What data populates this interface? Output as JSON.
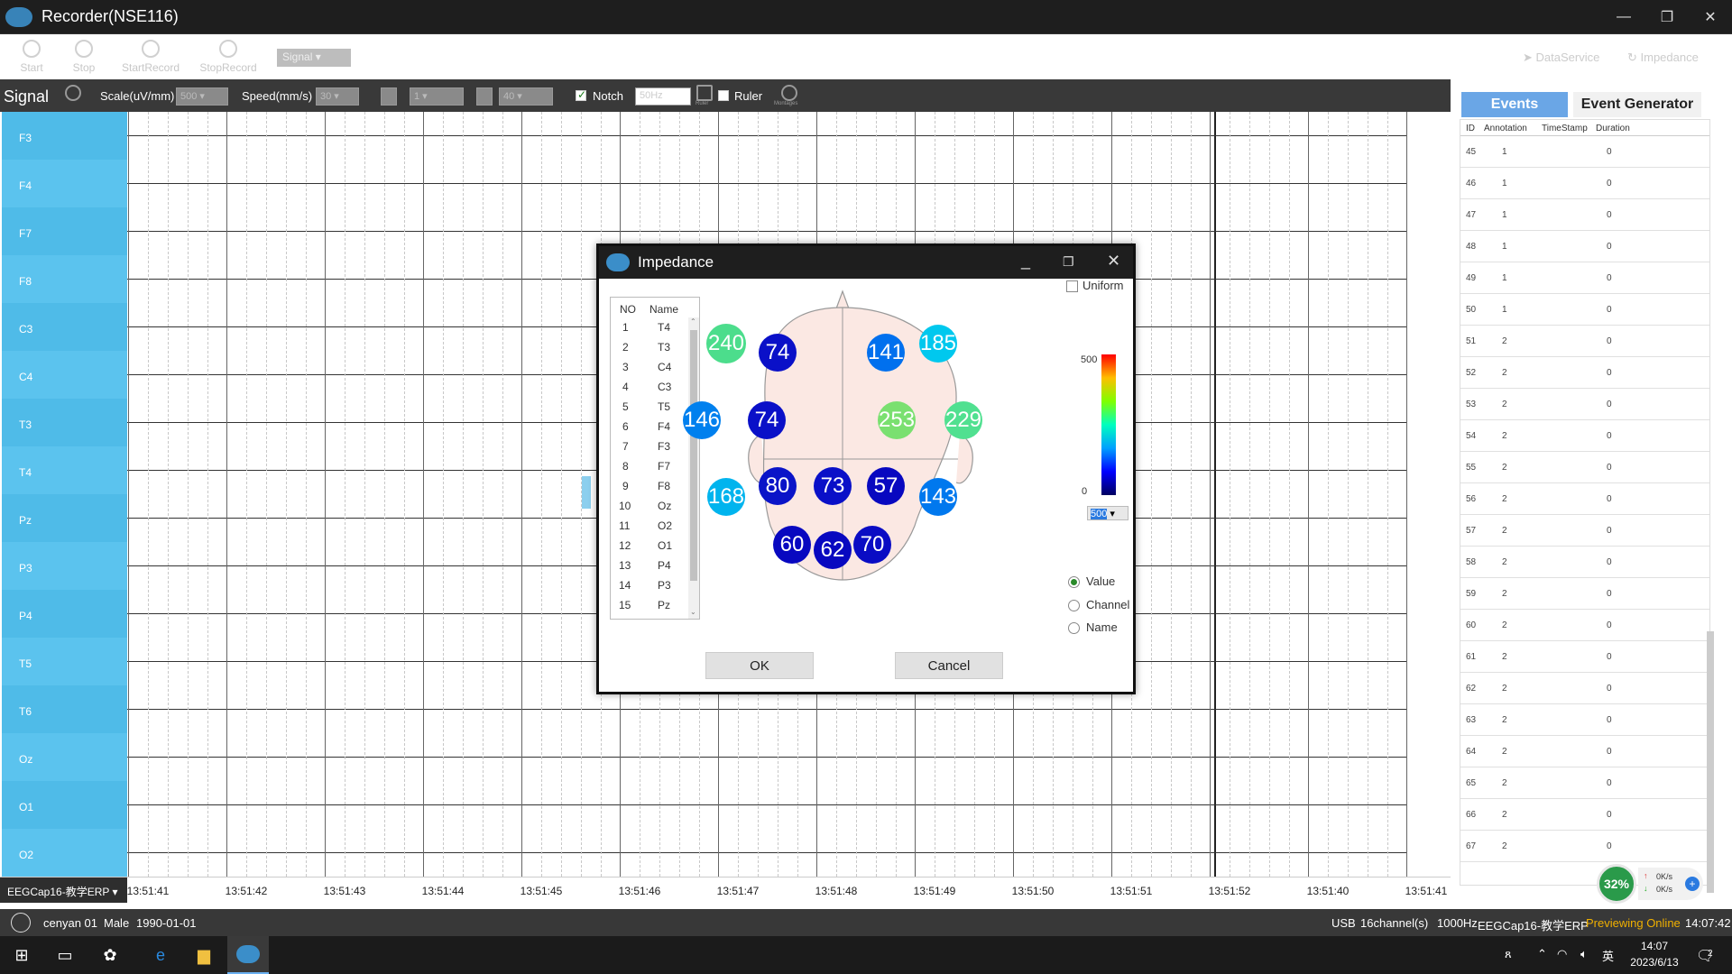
{
  "window": {
    "title": "Recorder(NSE116)"
  },
  "toolbar": {
    "start": "Start",
    "stop": "Stop",
    "start_record": "StartRecord",
    "stop_record": "StopRecord",
    "mode_select": "Signal",
    "data_service": "DataService",
    "impedance": "Impedance"
  },
  "signal_bar": {
    "title": "Signal",
    "reset": "Reset",
    "scale_label": "Scale(uV/mm)",
    "scale_value": "500",
    "speed_label": "Speed(mm/s)",
    "speed_value": "30",
    "low_value": "1",
    "high_value": "40",
    "notch_label": "Notch",
    "notch_checked": true,
    "notch_value": "50Hz",
    "ruler_icon_label": "Ruler",
    "ruler_label": "Ruler",
    "montages_label": "Montages"
  },
  "channels": [
    "F3",
    "F4",
    "F7",
    "F8",
    "C3",
    "C4",
    "T3",
    "T4",
    "Pz",
    "P3",
    "P4",
    "T5",
    "T6",
    "Oz",
    "O1",
    "O2"
  ],
  "time_axis": {
    "montage": "EEGCap16-教学ERP",
    "ticks": [
      "13:51:41",
      "13:51:42",
      "13:51:43",
      "13:51:44",
      "13:51:45",
      "13:51:46",
      "13:51:47",
      "13:51:48",
      "13:51:49",
      "13:51:50",
      "13:51:51",
      "13:51:52",
      "13:51:40",
      "13:51:41"
    ]
  },
  "right_panel": {
    "tab_events": "Events",
    "tab_generator": "Event Generator",
    "headers": [
      "ID",
      "Annotation",
      "TimeStamp",
      "Duration"
    ],
    "rows": [
      {
        "id": "45",
        "annotation": "1",
        "timestamp": "",
        "duration": "0"
      },
      {
        "id": "46",
        "annotation": "1",
        "timestamp": "",
        "duration": "0"
      },
      {
        "id": "47",
        "annotation": "1",
        "timestamp": "",
        "duration": "0"
      },
      {
        "id": "48",
        "annotation": "1",
        "timestamp": "",
        "duration": "0"
      },
      {
        "id": "49",
        "annotation": "1",
        "timestamp": "",
        "duration": "0"
      },
      {
        "id": "50",
        "annotation": "1",
        "timestamp": "",
        "duration": "0"
      },
      {
        "id": "51",
        "annotation": "2",
        "timestamp": "",
        "duration": "0"
      },
      {
        "id": "52",
        "annotation": "2",
        "timestamp": "",
        "duration": "0"
      },
      {
        "id": "53",
        "annotation": "2",
        "timestamp": "",
        "duration": "0"
      },
      {
        "id": "54",
        "annotation": "2",
        "timestamp": "",
        "duration": "0"
      },
      {
        "id": "55",
        "annotation": "2",
        "timestamp": "",
        "duration": "0"
      },
      {
        "id": "56",
        "annotation": "2",
        "timestamp": "",
        "duration": "0"
      },
      {
        "id": "57",
        "annotation": "2",
        "timestamp": "",
        "duration": "0"
      },
      {
        "id": "58",
        "annotation": "2",
        "timestamp": "",
        "duration": "0"
      },
      {
        "id": "59",
        "annotation": "2",
        "timestamp": "",
        "duration": "0"
      },
      {
        "id": "60",
        "annotation": "2",
        "timestamp": "",
        "duration": "0"
      },
      {
        "id": "61",
        "annotation": "2",
        "timestamp": "",
        "duration": "0"
      },
      {
        "id": "62",
        "annotation": "2",
        "timestamp": "",
        "duration": "0"
      },
      {
        "id": "63",
        "annotation": "2",
        "timestamp": "",
        "duration": "0"
      },
      {
        "id": "64",
        "annotation": "2",
        "timestamp": "",
        "duration": "0"
      },
      {
        "id": "65",
        "annotation": "2",
        "timestamp": "",
        "duration": "0"
      },
      {
        "id": "66",
        "annotation": "2",
        "timestamp": "",
        "duration": "0"
      },
      {
        "id": "67",
        "annotation": "2",
        "timestamp": "",
        "duration": "0"
      }
    ],
    "net_percent": "32%",
    "net_up": "0K/s",
    "net_down": "0K/s"
  },
  "status": {
    "patient": "cenyan 01",
    "gender": "Male",
    "dob": "1990-01-01",
    "device": "USB",
    "channels": "16channel(s)",
    "rate": "1000Hz",
    "montage": "EEGCap16-教学ERP",
    "mode": "Previewing Online",
    "time": "14:07:42"
  },
  "taskbar": {
    "clock_time": "14:07",
    "clock_date": "2023/6/13",
    "ime": "英",
    "notif_count": "2"
  },
  "impedance_dialog": {
    "title": "Impedance",
    "list_headers": {
      "no": "NO",
      "name": "Name"
    },
    "list": [
      {
        "no": "1",
        "name": "T4"
      },
      {
        "no": "2",
        "name": "T3"
      },
      {
        "no": "3",
        "name": "C4"
      },
      {
        "no": "4",
        "name": "C3"
      },
      {
        "no": "5",
        "name": "T5"
      },
      {
        "no": "6",
        "name": "F4"
      },
      {
        "no": "7",
        "name": "F3"
      },
      {
        "no": "8",
        "name": "F7"
      },
      {
        "no": "9",
        "name": "F8"
      },
      {
        "no": "10",
        "name": "Oz"
      },
      {
        "no": "11",
        "name": "O2"
      },
      {
        "no": "12",
        "name": "O1"
      },
      {
        "no": "13",
        "name": "P4"
      },
      {
        "no": "14",
        "name": "P3"
      },
      {
        "no": "15",
        "name": "Pz"
      }
    ],
    "uniform_label": "Uniform",
    "scale_max": "500",
    "scale_min": "0",
    "scale_select": "500",
    "radio_value": "Value",
    "radio_channel": "Channel",
    "radio_name": "Name",
    "ok": "OK",
    "cancel": "Cancel",
    "electrodes": [
      {
        "value": "240",
        "color": "#4cdd8c"
      },
      {
        "value": "74",
        "color": "#0a10c8"
      },
      {
        "value": "141",
        "color": "#0070ee"
      },
      {
        "value": "185",
        "color": "#00c8ee"
      },
      {
        "value": "146",
        "color": "#0080ee"
      },
      {
        "value": "74",
        "color": "#0a10c8"
      },
      {
        "value": "253",
        "color": "#7ae070"
      },
      {
        "value": "229",
        "color": "#50e090"
      },
      {
        "value": "168",
        "color": "#00b4ee"
      },
      {
        "value": "80",
        "color": "#0a14c8"
      },
      {
        "value": "73",
        "color": "#0a10c8"
      },
      {
        "value": "57",
        "color": "#0808c0"
      },
      {
        "value": "143",
        "color": "#0078ee"
      },
      {
        "value": "60",
        "color": "#0808c0"
      },
      {
        "value": "62",
        "color": "#0808c0"
      },
      {
        "value": "70",
        "color": "#0a0cc4"
      }
    ]
  }
}
